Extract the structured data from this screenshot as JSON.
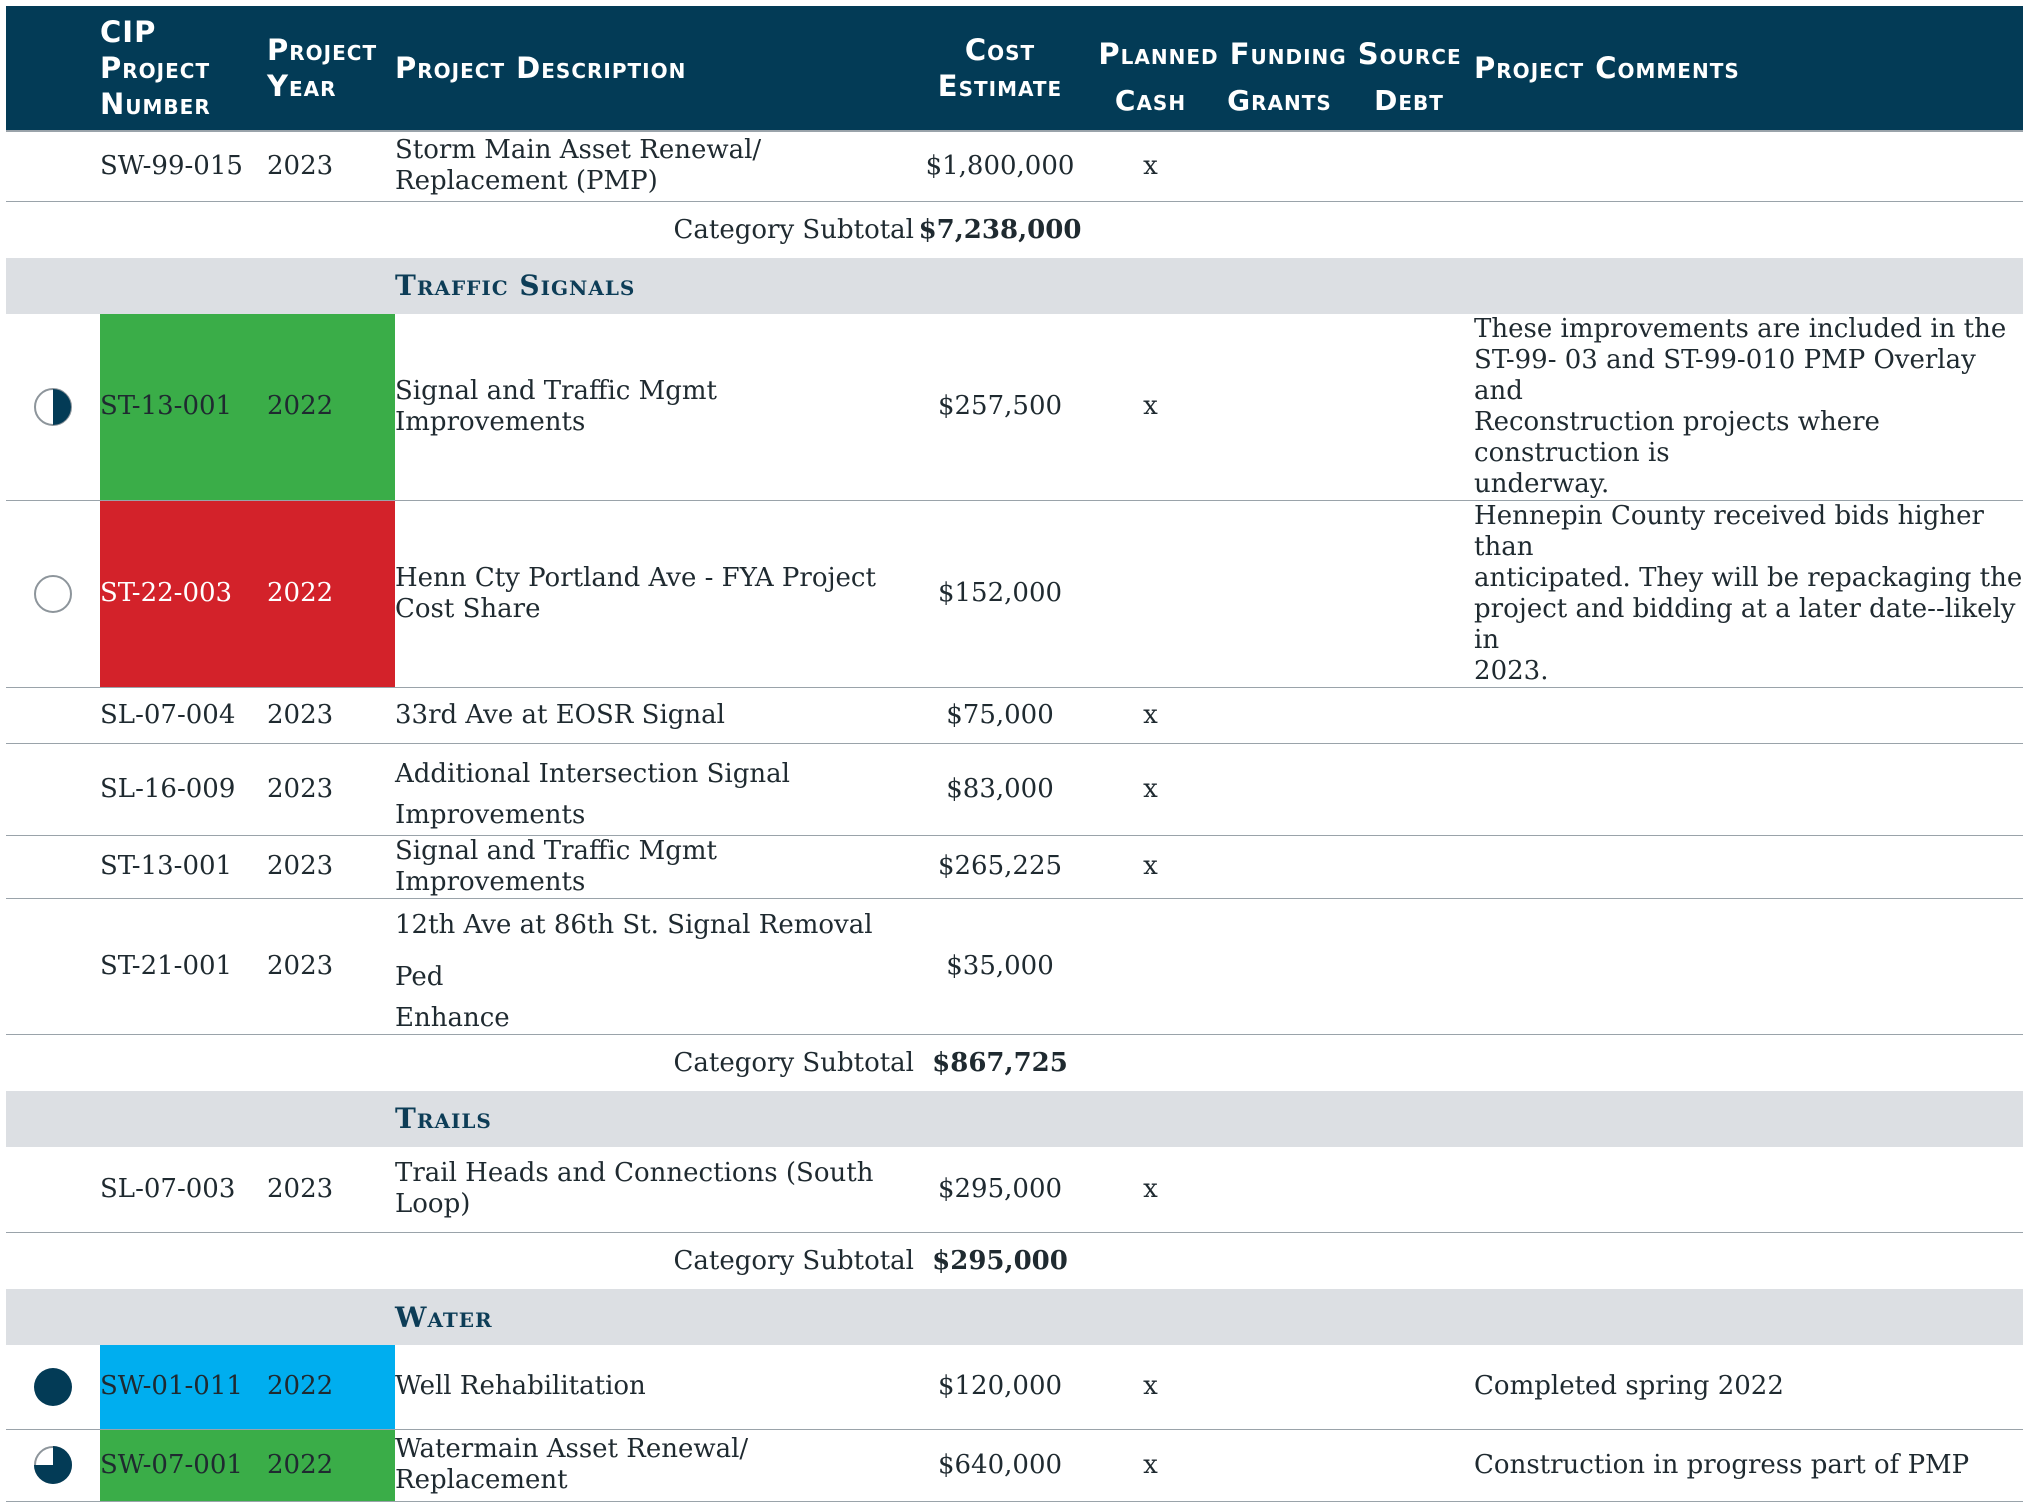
{
  "header": {
    "cip_project_number": [
      "CIP",
      "Project",
      "Number"
    ],
    "project_year": [
      "Project",
      "Year"
    ],
    "project_description": "Project Description",
    "cost_estimate": [
      "Cost",
      "Estimate"
    ],
    "planned_funding_source": "Planned Funding Source",
    "cash": "Cash",
    "grants": "Grants",
    "debt": "Debt",
    "project_comments": "Project Comments"
  },
  "rows": {
    "r0": {
      "number": "SW-99-015",
      "year": "2023",
      "desc": [
        "Storm Main Asset Renewal/",
        "Replacement (PMP)"
      ],
      "cost": "$1,800,000",
      "cash": "x"
    },
    "sub1": {
      "label": "Category Subtotal",
      "amount": "$7,238,000"
    },
    "cat_traffic": "Traffic Signals",
    "r1": {
      "status": "half-complete",
      "number": "ST-13-001",
      "year": "2022",
      "desc": "Signal and Traffic Mgmt Improvements",
      "cost": "$257,500",
      "cash": "x",
      "comment": [
        "These improvements are included in the",
        "ST-99- 03 and ST-99-010 PMP Overlay and",
        "Reconstruction projects where construction is",
        "underway."
      ],
      "highlight": "#3aad48"
    },
    "r2": {
      "status": "not-started",
      "number": "ST-22-003",
      "year": "2022",
      "desc": [
        "Henn Cty Portland Ave - FYA Project",
        "Cost Share"
      ],
      "cost": "$152,000",
      "comment": [
        "Hennepin County received bids higher than",
        "anticipated.  They will be repackaging the",
        "project and bidding at a later date--likely in",
        "2023."
      ],
      "highlight": "#d3222a"
    },
    "r3": {
      "number": "SL-07-004",
      "year": "2023",
      "desc": "33rd Ave at EOSR Signal",
      "cost": "$75,000",
      "cash": "x"
    },
    "r4": {
      "number": "SL-16-009",
      "year": "2023",
      "desc": [
        "Additional Intersection Signal",
        "Improvements"
      ],
      "cost": "$83,000",
      "cash": "x"
    },
    "r5": {
      "number": "ST-13-001",
      "year": "2023",
      "desc": "Signal and Traffic Mgmt Improvements",
      "cost": "$265,225",
      "cash": "x"
    },
    "r6": {
      "number": "ST-21-001",
      "year": "2023",
      "desc": [
        "12th Ave at 86th St. Signal Removal Ped",
        "Enhance"
      ],
      "cost": "$35,000"
    },
    "sub2": {
      "label": "Category Subtotal",
      "amount": "$867,725"
    },
    "cat_trails": "Trails",
    "r7": {
      "number": "SL-07-003",
      "year": "2023",
      "desc": [
        "Trail Heads and Connections (South",
        "Loop)"
      ],
      "cost": "$295,000",
      "cash": "x"
    },
    "sub3": {
      "label": "Category Subtotal",
      "amount": "$295,000"
    },
    "cat_water": "Water",
    "r8": {
      "status": "complete",
      "number": "SW-01-011",
      "year": "2022",
      "desc": "Well Rehabilitation",
      "cost": "$120,000",
      "cash": "x",
      "comment": "Completed spring 2022",
      "highlight": "#00aeef"
    },
    "r9": {
      "status": "three-quarter-complete",
      "number": "SW-07-001",
      "year": "2022",
      "desc": [
        "Watermain Asset Renewal/",
        "Replacement"
      ],
      "cost": "$640,000",
      "cash": "x",
      "comment": "Construction in progress part of PMP",
      "highlight": "#3aad48"
    }
  },
  "colors": {
    "header_bg": "#033b56",
    "category_bg": "#dcdfe3",
    "category_text": "#0d3d57",
    "on_track": "#3aad48",
    "delayed": "#d3222a",
    "complete": "#00aeef"
  }
}
